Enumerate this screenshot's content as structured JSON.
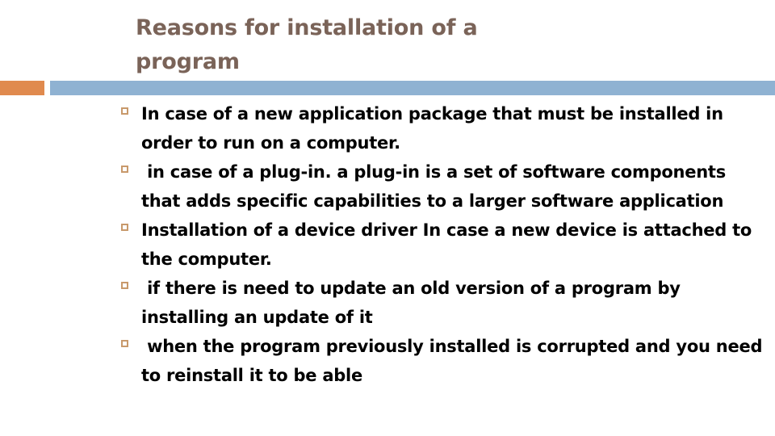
{
  "slide": {
    "title": "Reasons for installation of a\nprogram",
    "title_color": "#7a6358",
    "background_color": "#ffffff",
    "accent_orange_color": "#e08a4e",
    "accent_blue_color": "#8fb2d2",
    "bullet_marker_color": "#c8996b",
    "bullet_marker_icon": "hollow-square-bullet-icon",
    "body_text_color": "#000000",
    "bullets": [
      {
        "text": "In case of a new application package that must be installed in order to run on a computer."
      },
      {
        "text": " in case of a plug-in. a plug-in is a set of software components that adds specific capabilities to a larger software application"
      },
      {
        "text": "Installation of a device driver In case a new device is attached to the computer."
      },
      {
        "text": " if there is need to update an old version of a program by installing an update of it"
      },
      {
        "text": " when the program previously installed is corrupted and you need to reinstall it to be able"
      }
    ]
  }
}
